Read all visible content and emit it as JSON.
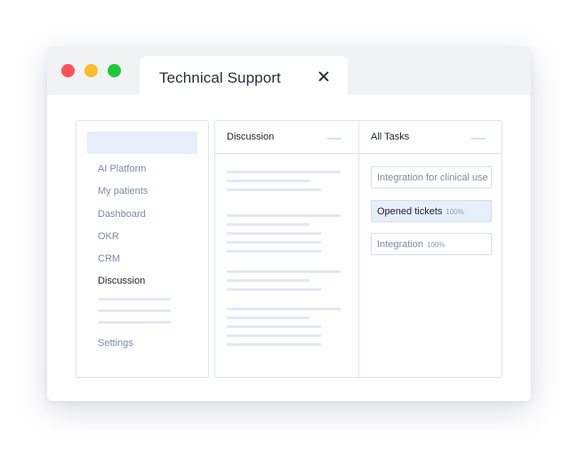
{
  "window": {
    "tab_title": "Technical Support"
  },
  "sidebar": {
    "items": [
      {
        "label": "AI Platform",
        "active": false
      },
      {
        "label": "My patients",
        "active": false
      },
      {
        "label": "Dashboard",
        "active": false
      },
      {
        "label": "OKR",
        "active": false
      },
      {
        "label": "CRM",
        "active": false
      },
      {
        "label": "Discussion",
        "active": true
      }
    ],
    "settings_label": "Settings"
  },
  "discussion": {
    "title": "Discussion"
  },
  "tasks": {
    "title": "All Tasks",
    "items": [
      {
        "label": "Integration for clinical use",
        "percent": "",
        "selected": false
      },
      {
        "label": "Opened tickets",
        "percent": "100%",
        "selected": true
      },
      {
        "label": "Integration",
        "percent": "100%",
        "selected": false
      }
    ]
  },
  "colors": {
    "close_red": "#ff5256",
    "minimize_yellow": "#fdbb2d",
    "maximize_green": "#1cc83c",
    "highlight_blue": "#e6eefb",
    "muted_text": "#7b8aa6",
    "dark_text": "#1d2230"
  }
}
